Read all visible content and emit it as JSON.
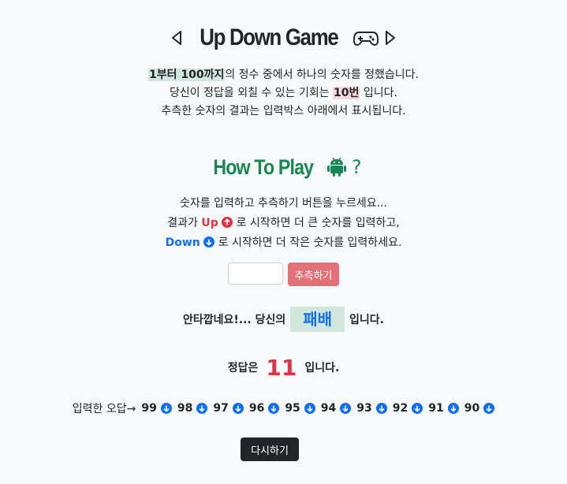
{
  "header": {
    "title": "Up Down Game",
    "icons": [
      "caret-left-icon",
      "gamepad-icon",
      "caret-right-icon"
    ]
  },
  "intro": {
    "line1_highlight": "1부터 100까지",
    "line1_rest": "의 정수 중에서 하나의 숫자를 정했습니다.",
    "line2_before": "당신이 정답을 외칠 수 있는 기회는 ",
    "line2_highlight": "10번",
    "line2_after": " 입니다.",
    "line3": "추측한 숫자의 결과는 입력박스 아래에서 표시됩니다."
  },
  "howto": {
    "title": "How To Play",
    "question_mark": "?",
    "icon": "android-icon",
    "line1": "숫자를 입력하고 추측하기 버튼을 누르세요...",
    "line2_before": "결과가 ",
    "line2_up": "Up",
    "line2_after": " 로 시작하면 더 큰 숫자를 입력하고,",
    "line3_down": "Down",
    "line3_after": " 로 시작하면 더 작은 숫자를 입력하세요."
  },
  "form": {
    "input_value": "",
    "guess_button": "추측하기"
  },
  "result": {
    "before": "안타깝네요!... 당신의",
    "badge": "패배",
    "after": "입니다."
  },
  "answer": {
    "before": "정답은",
    "number": "11",
    "after": "입니다."
  },
  "wrong_guesses": {
    "label": "입력한 오답→",
    "values": [
      "99",
      "98",
      "97",
      "96",
      "95",
      "94",
      "93",
      "92",
      "91",
      "90"
    ]
  },
  "restart_button": "다시하기",
  "colors": {
    "up": "#dc3545",
    "down": "#0d6efd",
    "highlight_green": "#d1e7dd",
    "highlight_red": "#f8d7da",
    "howto_green": "#198754"
  }
}
